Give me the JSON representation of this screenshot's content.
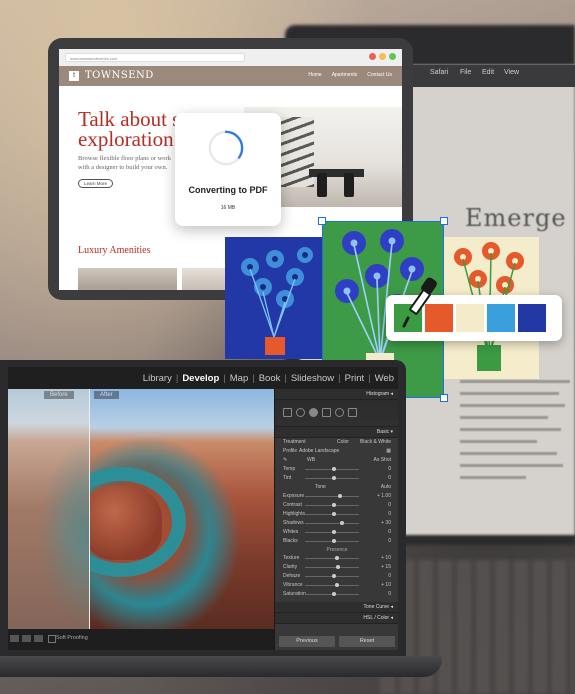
{
  "background": {
    "menu_items": [
      "Safari",
      "File",
      "Edit",
      "View"
    ],
    "headline": "Emerge"
  },
  "tablet": {
    "browser": {
      "url": "www.townsendhomes.com",
      "dot_colors": [
        "#ec5f57",
        "#f4bf4f",
        "#62c656"
      ]
    },
    "site": {
      "logo_letter": "t",
      "name": "TOWNSEND",
      "nav": [
        "Home",
        "Apartments",
        "Contact Us"
      ],
      "hero_title": "Talk about s exploration.",
      "hero_text": "Browse flexible floor plans or work with a designer to build your own.",
      "learn_more": "Learn More",
      "section_title": "Luxury Amenities",
      "accent": "#b92c20"
    },
    "converting": {
      "title": "Converting to PDF",
      "size": "16 MB",
      "progress": 0.35,
      "spinner_color": "#2f7be5"
    }
  },
  "artwork": {
    "panel_colors": [
      "#2238a6",
      "#3d9a46",
      "#f5eccb"
    ],
    "selection_color": "#1f6fe0",
    "palette": [
      "#3a9b42",
      "#e5592a",
      "#f3ebc9",
      "#3aa0dd",
      "#2239a4"
    ]
  },
  "lightroom": {
    "modules": [
      "Library",
      "Develop",
      "Map",
      "Book",
      "Slideshow",
      "Print",
      "Web"
    ],
    "active_module": "Develop",
    "before_label": "Before",
    "after_label": "After",
    "soft_proofing": "Soft Proofing",
    "panels": {
      "histogram": "Histogram",
      "basic": "Basic",
      "treatment": "Treatment",
      "color": "Color",
      "bw": "Black & White",
      "profile_label": "Profile",
      "profile_value": "Adobe Landscape",
      "wb_label": "WB",
      "wb_value": "As Shot",
      "temp": "Temp",
      "tint": "Tint",
      "tone": "Tone",
      "auto": "Auto",
      "exposure": "Exposure",
      "exposure_val": "+ 1.00",
      "contrast": "Contrast",
      "contrast_val": "0",
      "highlights": "Highlights",
      "highlights_val": "0",
      "shadows": "Shadows",
      "shadows_val": "+ 30",
      "whites": "Whites",
      "whites_val": "0",
      "blacks": "Blacks",
      "blacks_val": "0",
      "presence": "Presence",
      "texture": "Texture",
      "texture_val": "+ 10",
      "clarity": "Clarity",
      "clarity_val": "+ 15",
      "dehaze": "Dehaze",
      "dehaze_val": "0",
      "vibrance": "Vibrance",
      "vibrance_val": "+ 10",
      "saturation": "Saturation",
      "saturation_val": "0",
      "tone_curve": "Tone Curve",
      "hsl": "HSL / Color",
      "previous": "Previous",
      "reset": "Reset"
    }
  }
}
